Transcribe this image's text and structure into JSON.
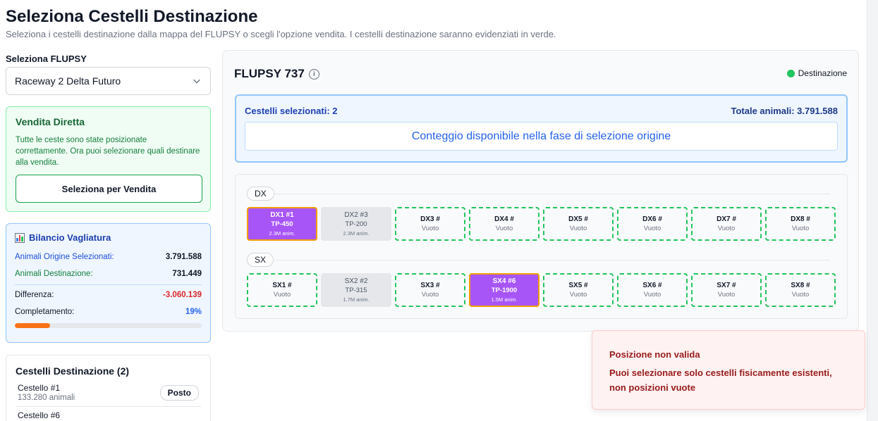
{
  "header": {
    "title": "Seleziona Cestelli Destinazione",
    "subtitle": "Seleziona i cestelli destinazione dalla mappa del FLUPSY o scegli l'opzione vendita. I cestelli destinazione saranno evidenziati in verde."
  },
  "flupsy_select": {
    "label": "Seleziona FLUPSY",
    "value": "Raceway 2 Delta Futuro"
  },
  "vendita": {
    "title": "Vendita Diretta",
    "text": "Tutte le ceste sono state posizionate correttamente. Ora puoi selezionare quali destinare alla vendita.",
    "button": "Seleziona per Vendita"
  },
  "bilancio": {
    "title": "Bilancio Vagliatura",
    "origine_label": "Animali Origine Selezionati:",
    "origine_value": "3.791.588",
    "destinazione_label": "Animali Destinazione:",
    "destinazione_value": "731.449",
    "differenza_label": "Differenza:",
    "differenza_value": "-3.060.139",
    "completamento_label": "Completamento:",
    "completamento_value": "19%",
    "completamento_fraction": 0.19
  },
  "destinazioni": {
    "title": "Cestelli Destinazione (2)",
    "items": [
      {
        "name": "Cestello #1",
        "sub": "133.280 animali",
        "action": "Posto"
      },
      {
        "name": "Cestello #6",
        "sub": "",
        "action": ""
      }
    ]
  },
  "flupsy": {
    "title": "FLUPSY 737",
    "legend_label": "Destinazione",
    "selezionati_label": "Cestelli selezionati: 2",
    "totale_label": "Totale animali: 3.791.588",
    "conteggio": "Conteggio disponibile nella fase di selezione origine"
  },
  "rows": [
    {
      "label": "DX",
      "cells": [
        {
          "name": "DX1 #1",
          "sub": "TP-450",
          "anim": "2.3M anim.",
          "state": "sel"
        },
        {
          "name": "DX2 #3",
          "sub": "TP-200",
          "anim": "2.3M anim.",
          "state": "occ"
        },
        {
          "name": "DX3 #",
          "sub": "Vuoto",
          "anim": "",
          "state": "empty"
        },
        {
          "name": "DX4 #",
          "sub": "Vuoto",
          "anim": "",
          "state": "empty"
        },
        {
          "name": "DX5 #",
          "sub": "Vuoto",
          "anim": "",
          "state": "empty"
        },
        {
          "name": "DX6 #",
          "sub": "Vuoto",
          "anim": "",
          "state": "empty"
        },
        {
          "name": "DX7 #",
          "sub": "Vuoto",
          "anim": "",
          "state": "empty"
        },
        {
          "name": "DX8 #",
          "sub": "Vuoto",
          "anim": "",
          "state": "empty"
        }
      ]
    },
    {
      "label": "SX",
      "cells": [
        {
          "name": "SX1 #",
          "sub": "Vuoto",
          "anim": "",
          "state": "empty"
        },
        {
          "name": "SX2 #2",
          "sub": "TP-315",
          "anim": "1.7M anim.",
          "state": "occ"
        },
        {
          "name": "SX3 #",
          "sub": "Vuoto",
          "anim": "",
          "state": "empty"
        },
        {
          "name": "SX4 #6",
          "sub": "TP-1900",
          "anim": "1.5M anim.",
          "state": "sel"
        },
        {
          "name": "SX5 #",
          "sub": "Vuoto",
          "anim": "",
          "state": "empty"
        },
        {
          "name": "SX6 #",
          "sub": "Vuoto",
          "anim": "",
          "state": "empty"
        },
        {
          "name": "SX7 #",
          "sub": "Vuoto",
          "anim": "",
          "state": "empty"
        },
        {
          "name": "SX8 #",
          "sub": "Vuoto",
          "anim": "",
          "state": "empty"
        }
      ]
    }
  ],
  "toast": {
    "title": "Posizione non valida",
    "message": "Puoi selezionare solo cestelli fisicamente esistenti, non posizioni vuote"
  },
  "colors": {
    "selected": "#a855f7",
    "selected_border": "#f59e0b",
    "destination": "#22c55e",
    "occupied": "#e5e7eb",
    "progress": "#f97316"
  },
  "icons": {
    "select": "chevron-down-icon",
    "info": "info-icon",
    "bilancio": "bar-chart-icon",
    "legend": "destination-dot-icon"
  }
}
